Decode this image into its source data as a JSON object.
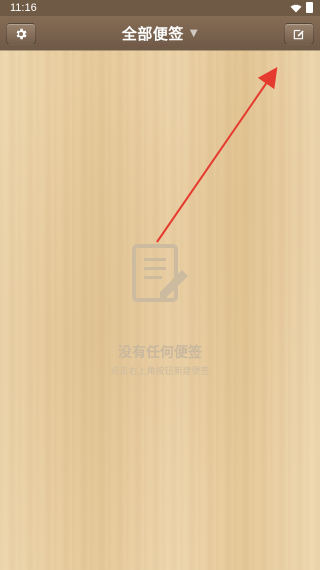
{
  "status_bar": {
    "time": "11:16",
    "wifi_icon": "wifi-icon",
    "battery_icon": "battery-icon"
  },
  "app_bar": {
    "title": "全部便签",
    "left_icon": "gear-icon",
    "right_icon": "compose-icon"
  },
  "empty_state": {
    "icon": "note-edit-icon",
    "title": "没有任何便签",
    "subtitle": "点击右上角按钮新建便签"
  },
  "colors": {
    "appbar": "#7a624d",
    "wood_light": "#efd9b0",
    "wood_dark": "#e6ca9a",
    "arrow_red": "#e53b2f",
    "empty_text": "#c9b79e"
  }
}
